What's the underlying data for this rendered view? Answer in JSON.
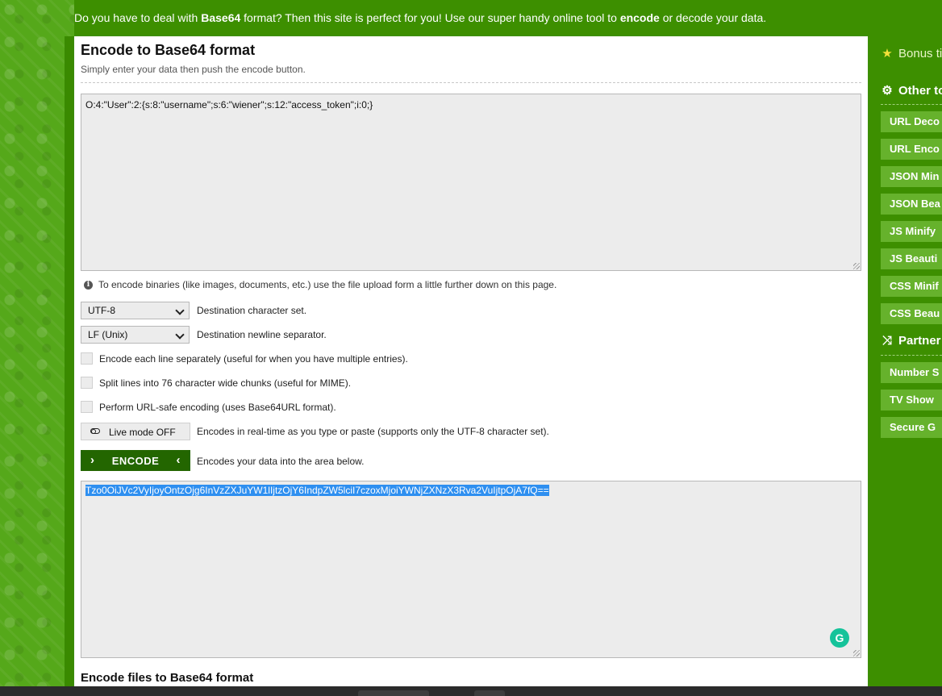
{
  "header": {
    "intro_part1": "Do you have to deal with ",
    "intro_bold1": "Base64",
    "intro_part2": " format? Then this site is perfect for you! Use our super handy online tool to ",
    "intro_bold2": "encode",
    "intro_part3": " or decode your data."
  },
  "main": {
    "title": "Encode to Base64 format",
    "subtitle": "Simply enter your data then push the encode button.",
    "input_value": "O:4:\"User\":2:{s:8:\"username\";s:6:\"wiener\";s:12:\"access_token\";i:0;}",
    "info_text": "To encode binaries (like images, documents, etc.) use the file upload form a little further down on this page.",
    "charset": {
      "value": "UTF-8",
      "label": "Destination character set."
    },
    "newline": {
      "value": "LF (Unix)",
      "label": "Destination newline separator."
    },
    "options": [
      {
        "label": "Encode each line separately (useful for when you have multiple entries).",
        "checked": false
      },
      {
        "label": "Split lines into 76 character wide chunks (useful for MIME).",
        "checked": false
      },
      {
        "label": "Perform URL-safe encoding (uses Base64URL format).",
        "checked": false
      }
    ],
    "live_mode": {
      "label": "Live mode OFF",
      "desc": "Encodes in real-time as you type or paste (supports only the UTF-8 character set)."
    },
    "encode": {
      "label": "ENCODE",
      "desc": "Encodes your data into the area below."
    },
    "output_value": "Tzo0OiJVc2VyIjoyOntzOjg6InVzZXJuYW1lIjtzOjY6IndpZW5lciI7czoxMjoiYWNjZXNzX3Rva2VuIjtpOjA7fQ==",
    "files_title": "Encode files to Base64 format"
  },
  "sidebar": {
    "bonus": "Bonus ti",
    "other_tools": "Other to",
    "tools": [
      "URL Deco",
      "URL Enco",
      "JSON Min",
      "JSON Bea",
      "JS Minify",
      "JS Beauti",
      "CSS Minif",
      "CSS Beau"
    ],
    "partners": "Partner",
    "partner_links": [
      "Number S",
      "TV Show",
      "Secure G"
    ]
  },
  "colors": {
    "brand_green": "#3d8f00",
    "button_green": "#236600",
    "sidebar_item": "#66b22c",
    "selection": "#2e8ff0"
  }
}
